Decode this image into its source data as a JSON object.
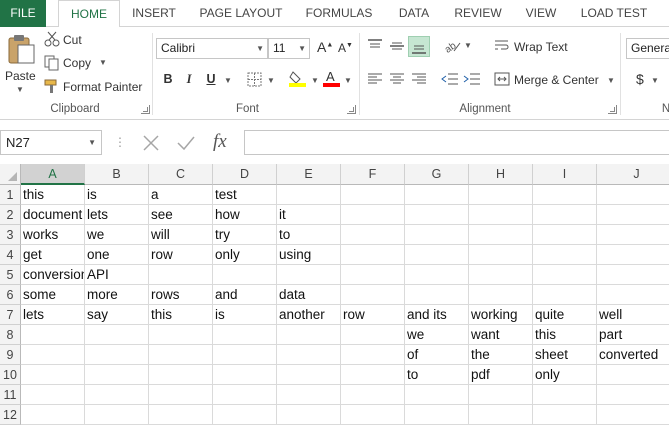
{
  "tabs": {
    "file": "FILE",
    "home": "HOME",
    "insert": "INSERT",
    "page_layout": "PAGE LAYOUT",
    "formulas": "FORMULAS",
    "data": "DATA",
    "review": "REVIEW",
    "view": "VIEW",
    "load_test": "LOAD TEST"
  },
  "clipboard": {
    "paste": "Paste",
    "cut": "Cut",
    "copy": "Copy",
    "format_painter": "Format Painter",
    "label": "Clipboard"
  },
  "font": {
    "name": "Calibri",
    "size": "11",
    "bold": "B",
    "italic": "I",
    "underline": "U",
    "label": "Font"
  },
  "alignment": {
    "wrap_text": "Wrap Text",
    "merge_center": "Merge & Center",
    "label": "Alignment"
  },
  "number": {
    "format": "General",
    "currency": "$",
    "label": "N"
  },
  "formula_bar": {
    "name_box": "N27",
    "fx": "fx",
    "value": ""
  },
  "grid": {
    "columns": [
      "A",
      "B",
      "C",
      "D",
      "E",
      "F",
      "G",
      "H",
      "I",
      "J"
    ],
    "selected_column": "A",
    "rows": [
      [
        "this",
        "is",
        "a",
        "test",
        "",
        "",
        "",
        "",
        "",
        ""
      ],
      [
        "document",
        "lets",
        "see",
        "how",
        "it",
        "",
        "",
        "",
        "",
        ""
      ],
      [
        "works",
        "we",
        "will",
        "try",
        "to",
        "",
        "",
        "",
        "",
        ""
      ],
      [
        "get",
        "one",
        "row",
        "only",
        "using",
        "",
        "",
        "",
        "",
        ""
      ],
      [
        "conversion",
        "API",
        "",
        "",
        "",
        "",
        "",
        "",
        "",
        ""
      ],
      [
        "some",
        "more",
        "rows",
        "and",
        "data",
        "",
        "",
        "",
        "",
        ""
      ],
      [
        "lets",
        "say",
        "this",
        "is",
        "another",
        "row",
        "and its",
        "working",
        "quite",
        "well"
      ],
      [
        "",
        "",
        "",
        "",
        "",
        "",
        "we",
        "want",
        "this",
        "part"
      ],
      [
        "",
        "",
        "",
        "",
        "",
        "",
        "of",
        "the",
        "sheet",
        "converted"
      ],
      [
        "",
        "",
        "",
        "",
        "",
        "",
        "to",
        "pdf",
        "only",
        ""
      ],
      [
        "",
        "",
        "",
        "",
        "",
        "",
        "",
        "",
        "",
        ""
      ],
      [
        "",
        "",
        "",
        "",
        "",
        "",
        "",
        "",
        "",
        ""
      ]
    ]
  },
  "colors": {
    "accent": "#217346",
    "font_highlight": "#ffff00",
    "font_color": "#ff0000"
  }
}
